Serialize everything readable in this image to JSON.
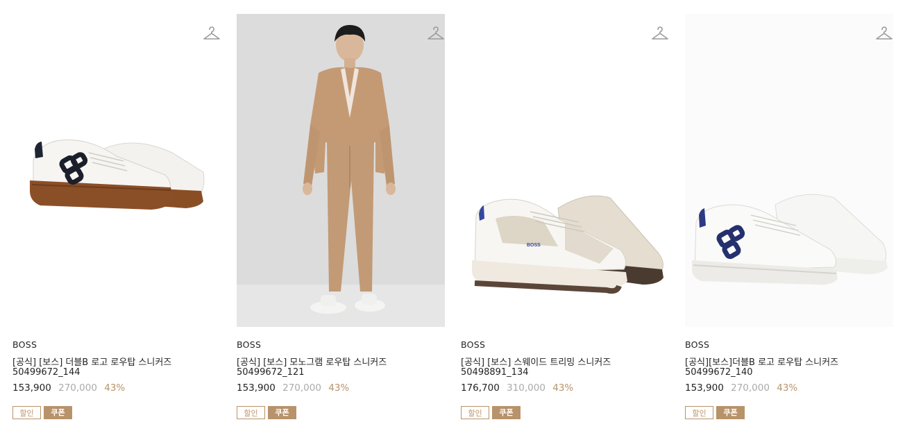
{
  "products": [
    {
      "brand": "BOSS",
      "title": "[공식] [보스] 더블B 로고 로우탑 스니커즈",
      "code": "50499672_144",
      "price": "153,900",
      "original_price": "270,000",
      "discount": "43%",
      "tags": [
        "할인",
        "쿠폰"
      ]
    },
    {
      "brand": "BOSS",
      "title": "[공식] [보스] 모노그램 로우탑 스니커즈",
      "code": "50499672_121",
      "price": "153,900",
      "original_price": "270,000",
      "discount": "43%",
      "tags": [
        "할인",
        "쿠폰"
      ]
    },
    {
      "brand": "BOSS",
      "title": "[공식] [보스] 스웨이드 트리밍 스니커즈",
      "code": "50498891_134",
      "price": "176,700",
      "original_price": "310,000",
      "discount": "43%",
      "tags": [
        "할인",
        "쿠폰"
      ]
    },
    {
      "brand": "BOSS",
      "title": "[공식][보스]더블B 로고 로우탑 스니커즈",
      "code": "50499672_140",
      "price": "153,900",
      "original_price": "270,000",
      "discount": "43%",
      "tags": [
        "할인",
        "쿠폰"
      ]
    }
  ],
  "icons": {
    "wishlist": "hanger-icon"
  },
  "colors": {
    "accent": "#b8926a",
    "muted": "#aaaaaa",
    "text": "#222222"
  }
}
